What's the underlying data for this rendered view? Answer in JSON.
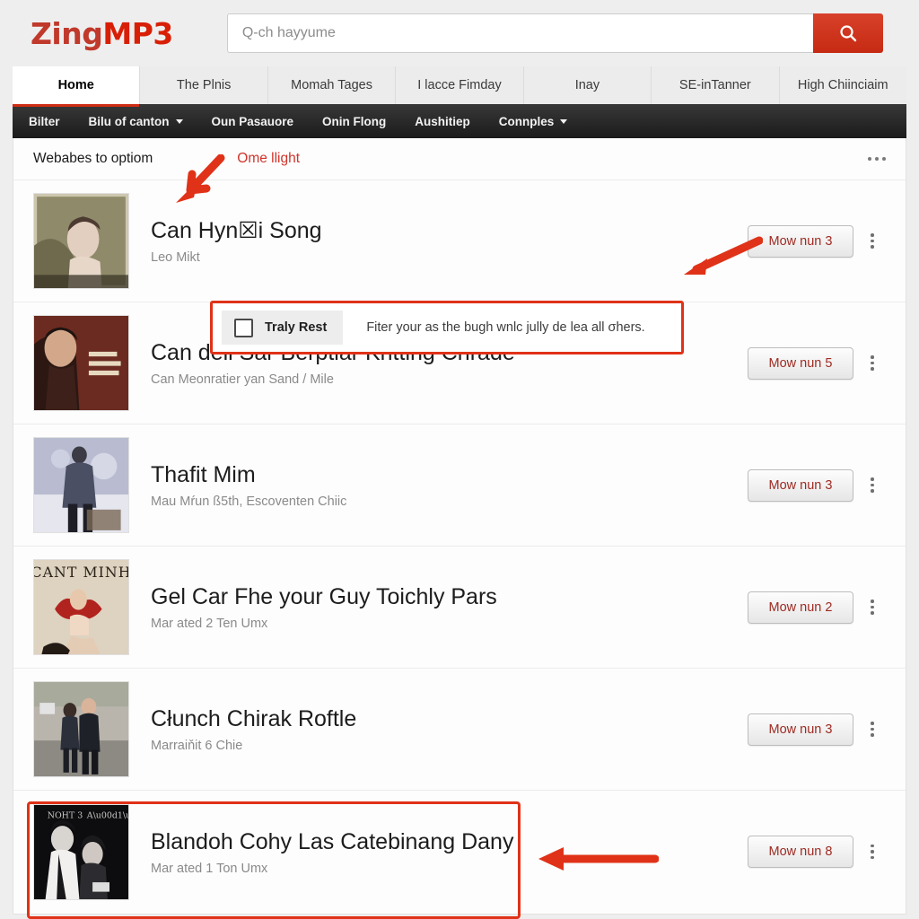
{
  "brand": {
    "part1": "Zing",
    "part2": "MP3"
  },
  "search": {
    "placeholder": "Q-ch hayyume",
    "value": "",
    "button_icon": "search-icon"
  },
  "tabs": [
    {
      "label": "Home",
      "active": true
    },
    {
      "label": "The Plnis",
      "active": false
    },
    {
      "label": "Momah Tages",
      "active": false
    },
    {
      "label": "I lacce Fimday",
      "active": false
    },
    {
      "label": "Inay",
      "active": false
    },
    {
      "label": "SE-inTanner",
      "active": false
    },
    {
      "label": "High Chiinciaim",
      "active": false
    }
  ],
  "subnav": [
    {
      "label": "Bilter",
      "caret": false
    },
    {
      "label": "Bilu of canton",
      "caret": true
    },
    {
      "label": "Oun Pasauore",
      "caret": false
    },
    {
      "label": "Onin Flong",
      "caret": false
    },
    {
      "label": "Aushitiep",
      "caret": false
    },
    {
      "label": "Connples",
      "caret": true
    }
  ],
  "panel": {
    "title": "Webabes to optiom",
    "subtitle": "Ome llight",
    "overflow_icon": "more-horizontal-icon"
  },
  "tooltip": {
    "checkbox_label": "Traly Rest",
    "checkbox_checked": false,
    "description": "Fiter your as the bugh wnlc jully de lea all σhers."
  },
  "rows": [
    {
      "title": "Can Hyn☒i Song",
      "subtitle": "Leo Mikt",
      "action": "Mow nun 3",
      "menu_icon": "more-vertical-icon",
      "highlighted": false
    },
    {
      "title": "Can dell Sar Berptiar Kritting Chrade",
      "subtitle": "Can Meonratier yan Sand / Mile",
      "action": "Mow nun 5",
      "menu_icon": "more-vertical-icon",
      "highlighted": false
    },
    {
      "title": "Thafit Mim",
      "subtitle": "Mau Mŕun ß5th, Escoventen Chiic",
      "action": "Mow nun 3",
      "menu_icon": "more-vertical-icon",
      "highlighted": false
    },
    {
      "title": "Gel Car Fhe your Guy Toichly Pars",
      "subtitle": "Mar ated 2 Ten Umx",
      "action": "Mow nun 2",
      "menu_icon": "more-vertical-icon",
      "highlighted": false
    },
    {
      "title": "Cłunch Chirak Roftle",
      "subtitle": "Marraiňit 6 Chie",
      "action": "Mow nun 3",
      "menu_icon": "more-vertical-icon",
      "highlighted": false
    },
    {
      "title": "Blandoh Cohy Las Catebinang Dany",
      "subtitle": "Mar ated 1 Ton Umx",
      "action": "Mow nun 8",
      "menu_icon": "more-vertical-icon",
      "highlighted": true
    }
  ],
  "colors": {
    "brand_red": "#d81f06",
    "accent_red": "#cf2d14",
    "annotation_red": "#e03218",
    "button_text": "#9e2b22",
    "subnav_dark": "#1b1b1b",
    "page_bg": "#eeeeee"
  }
}
